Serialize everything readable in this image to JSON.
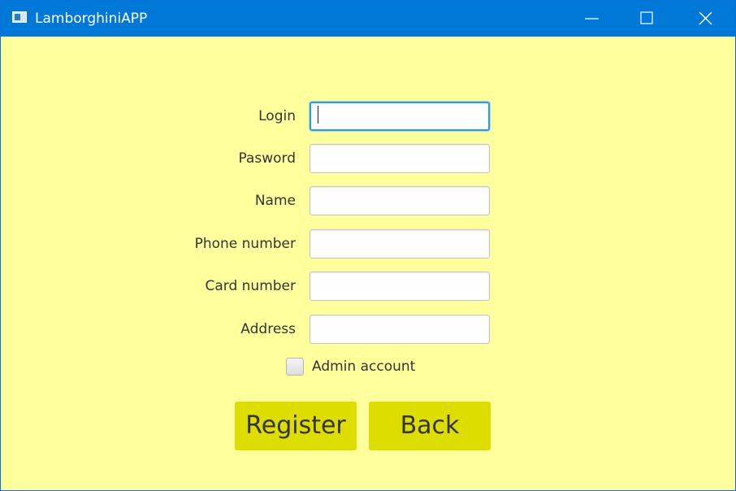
{
  "window": {
    "title": "LamborghiniAPP",
    "background_color": "#ffff9c",
    "titlebar_color": "#0078d7",
    "controls": [
      "minimize-icon",
      "maximize-icon",
      "close-icon"
    ]
  },
  "form": {
    "fields": [
      {
        "label": "Login",
        "value": ""
      },
      {
        "label": "Pasword",
        "value": ""
      },
      {
        "label": "Name",
        "value": ""
      },
      {
        "label": "Phone number",
        "value": ""
      },
      {
        "label": "Card number",
        "value": ""
      },
      {
        "label": "Address",
        "value": ""
      }
    ],
    "admin_checkbox": {
      "label": "Admin account",
      "checked": false
    },
    "register_label": "Register",
    "back_label": "Back",
    "button_color": "#dddd00"
  }
}
